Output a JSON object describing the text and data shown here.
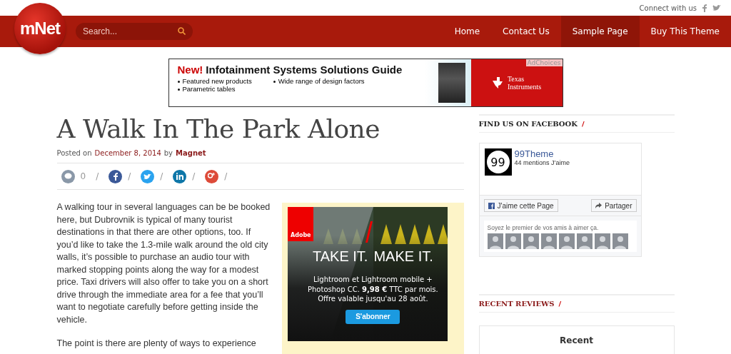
{
  "top_bar": {
    "connect_label": "Connect with us"
  },
  "nav": {
    "logo": "mNet",
    "search": {
      "placeholder": "Search..."
    },
    "items": [
      {
        "label": "Home",
        "selected": false
      },
      {
        "label": "Contact Us",
        "selected": false
      },
      {
        "label": "Sample Page",
        "selected": true
      },
      {
        "label": "Buy This Theme",
        "selected": false
      }
    ]
  },
  "banner_ad": {
    "accent": "New!",
    "headline": "Infotainment Systems Solutions Guide",
    "bullets": [
      "Featured new products",
      "Parametric tables",
      "Wide range of design factors"
    ],
    "ad_choices": "AdChoices",
    "brand_line_1": "Texas",
    "brand_line_2": "Instruments"
  },
  "article": {
    "title": "A Walk In The Park Alone",
    "meta": {
      "prefix": "Posted on",
      "date": "December 8, 2014",
      "by": "by",
      "author": "Magnet"
    },
    "share": [
      {
        "kind": "comment",
        "count": "0",
        "separator": "/"
      },
      {
        "kind": "facebook",
        "separator": "/"
      },
      {
        "kind": "twitter",
        "separator": "/"
      },
      {
        "kind": "linkedin",
        "separator": "/"
      },
      {
        "kind": "googleplus",
        "separator": "/"
      }
    ],
    "paragraphs": [
      "A walking tour in several languages can be be booked here, but Dubrovnik is typical of many tourist destinations in that there are other options, too. If you’d like to take the 1.3-mile walk around the old city walls, it’s possible to purchase an audio tour with marked stopping points along the way for a modest price. Taxi drivers will also offer to take you on a short drive through the immediate area for a fee that you’ll want to negotiate carefully before getting inside the vehicle.",
      "The point is there are plenty of ways to experience"
    ],
    "side_ad": {
      "brand": "Adobe",
      "headline_left": "TAKE IT.",
      "headline_right": "MAKE IT.",
      "lines": [
        "Lightroom et Lightroom mobile +",
        "Photoshop CC. **9,98 €** TTC par mois.",
        "Offre valable jusqu'au 28 août."
      ],
      "button": "S'abonner"
    }
  },
  "sidebar": {
    "facebook_widget": {
      "title": "FIND US ON FACEBOOK",
      "slash": "/",
      "page_logo": "99",
      "page_name": "99Theme",
      "likes": "44 mentions J’aime",
      "like_button": "J'aime cette Page",
      "share_button": "Partager",
      "friends_text": "Soyez le premier de vos amis à aimer ça."
    },
    "reviews_widget": {
      "title": "RECENT REVIEWS",
      "slash": "/",
      "tab": "Recent"
    }
  }
}
